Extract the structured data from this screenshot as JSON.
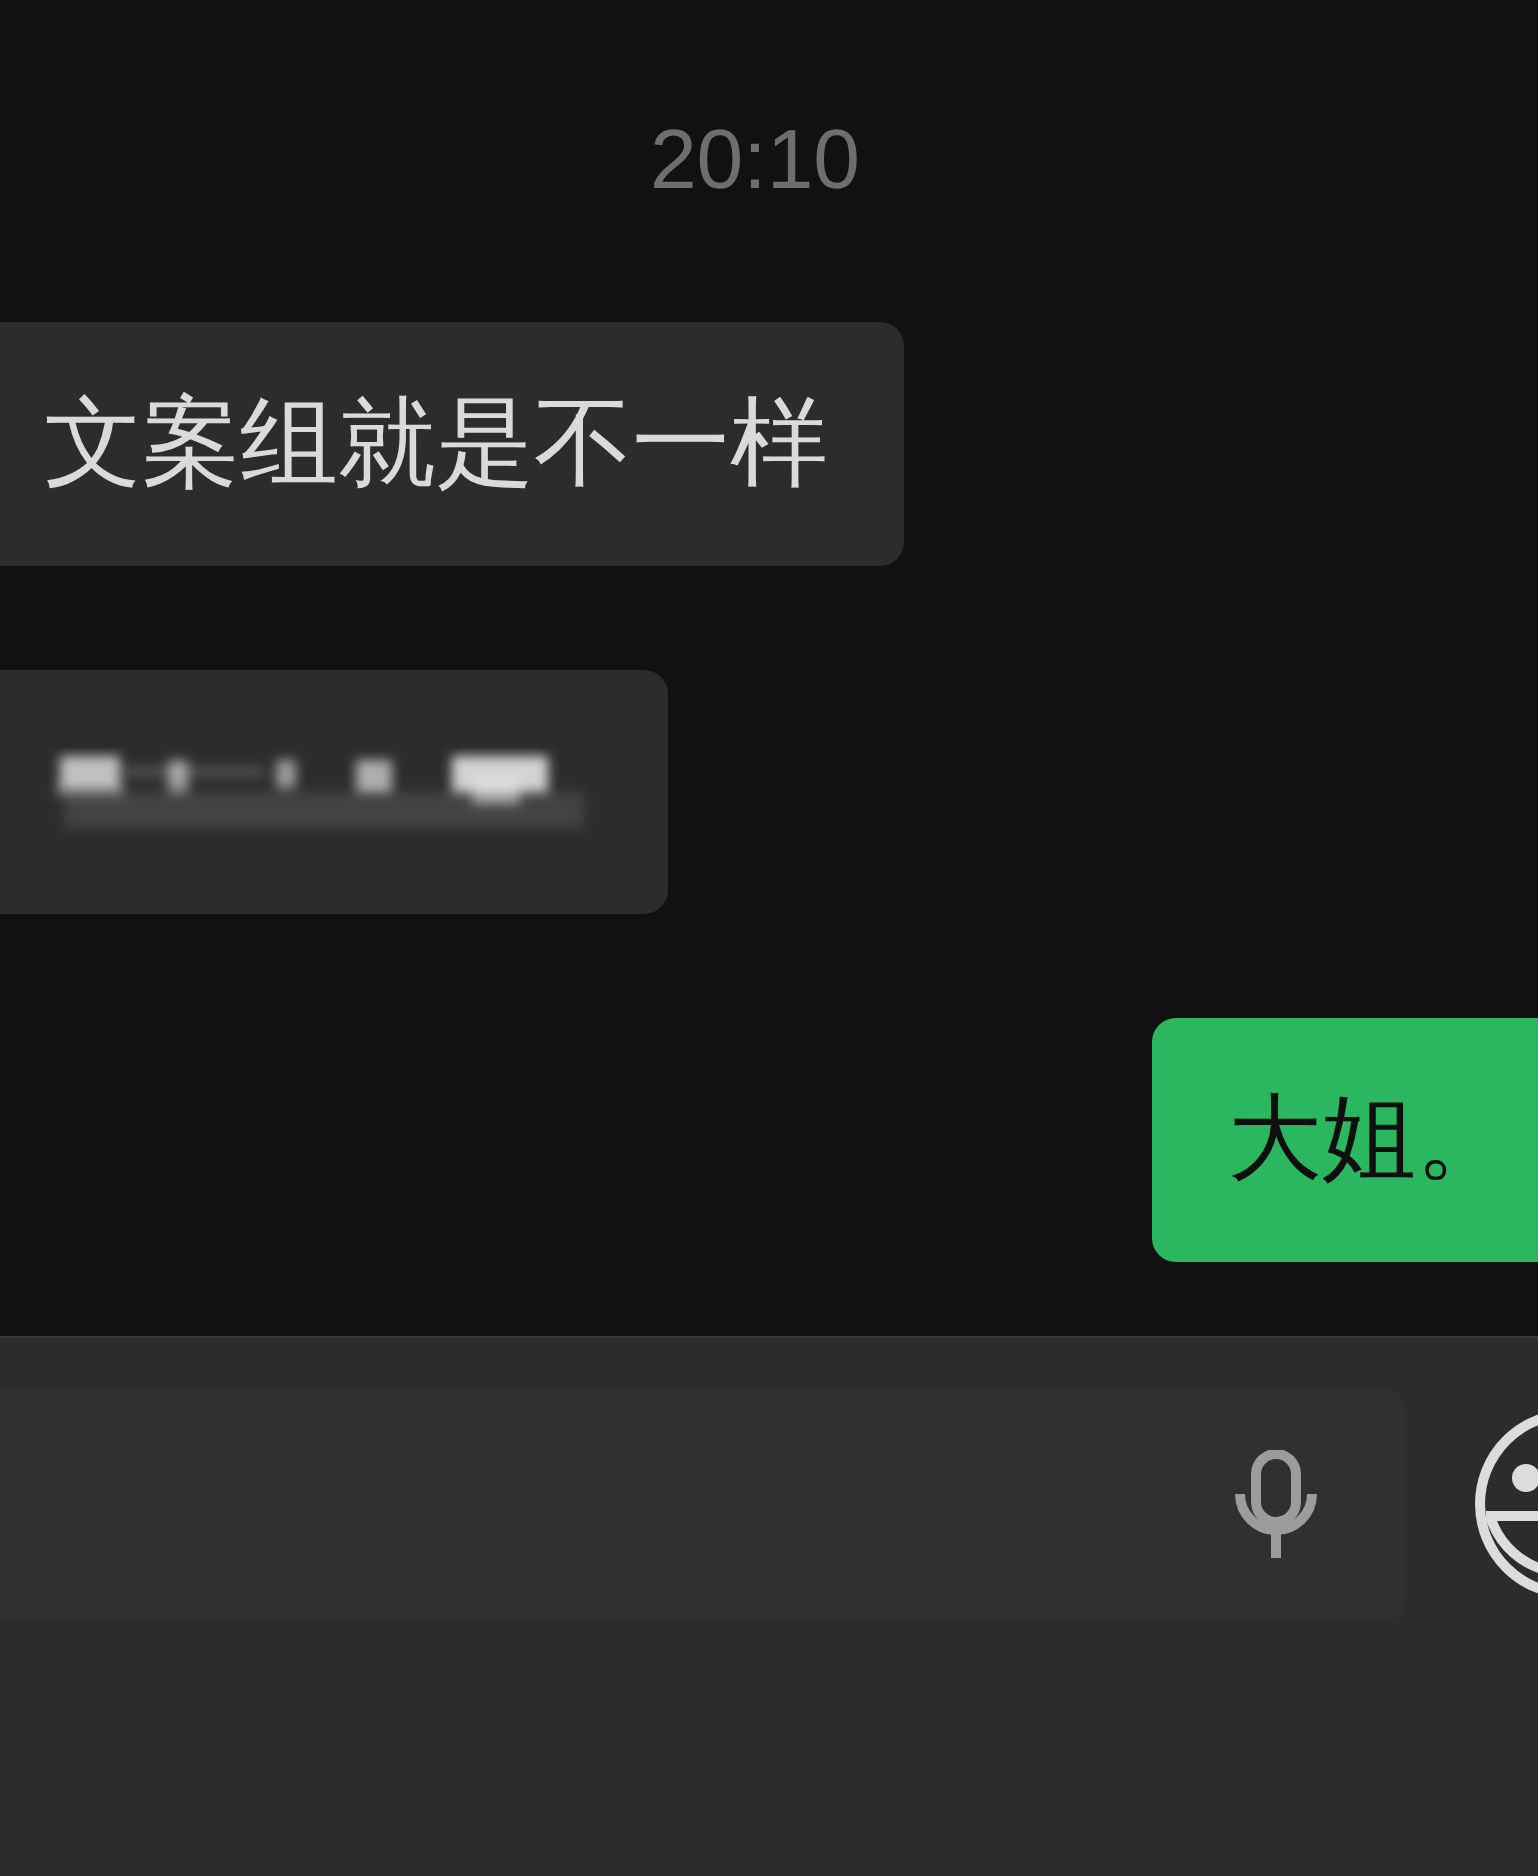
{
  "chat": [
    {
      "kind": "time",
      "text": "20:10"
    },
    {
      "kind": "text",
      "outgoing": false,
      "text": "文案组就是不一样"
    },
    {
      "kind": "blurred",
      "outgoing": false
    },
    {
      "kind": "text",
      "outgoing": true,
      "text": "大姐。"
    }
  ]
}
